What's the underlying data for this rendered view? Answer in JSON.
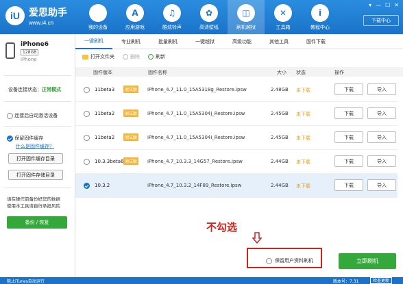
{
  "app": {
    "logo_mark": "iU",
    "name": "爱思助手",
    "url": "www.i4.cn",
    "download_center": "下载中心",
    "window_controls": [
      "▾",
      "—",
      "☐",
      "✕"
    ]
  },
  "nav": [
    {
      "label": "我的设备",
      "icon": "apple-icon",
      "glyph": ""
    },
    {
      "label": "应用游戏",
      "icon": "app-store-icon",
      "glyph": "A"
    },
    {
      "label": "酷炫铃声",
      "icon": "bell-icon",
      "glyph": "♫"
    },
    {
      "label": "高清壁纸",
      "icon": "wallpaper-icon",
      "glyph": "✿"
    },
    {
      "label": "刷机越狱",
      "icon": "flash-box-icon",
      "glyph": "◫",
      "active": true
    },
    {
      "label": "工具箱",
      "icon": "toolbox-icon",
      "glyph": "✕"
    },
    {
      "label": "教程中心",
      "icon": "info-icon",
      "glyph": "i"
    }
  ],
  "device": {
    "name": "iPhone6",
    "capacity": "128GB",
    "model": "iPhone"
  },
  "left": {
    "status_label": "设备连接状态：",
    "status_value": "正常模式",
    "auto_activate": "连接后自动激活设备",
    "keep_cache": "保留固件缓存",
    "cache_link": "什么是固件缓存？",
    "open_cache_dir": "打开固件缓存目录",
    "open_store_dir": "打开固件存储目录",
    "warning": "请在操作前备份好您的数据\n使用本工具请自行承担风险",
    "backup_button": "备份 / 恢复"
  },
  "tabs": [
    "一键刷机",
    "专业刷机",
    "批量刷机",
    "一键越狱",
    "高级功能",
    "其他工具",
    "固件下载"
  ],
  "toolbar": {
    "open_folder": "打开文件夹",
    "delete": "删除",
    "refresh": "刷新"
  },
  "table": {
    "headers": [
      "固件版本",
      "固件名称",
      "大小",
      "状态",
      "操作"
    ],
    "rows": [
      {
        "version": "11beta3",
        "badge": "测试版",
        "file": "iPhone_4.7_11.0_15A5318g_Restore.ipsw",
        "size": "2.48GB",
        "status": "未下载",
        "download": "下载",
        "import": "导入"
      },
      {
        "version": "11beta2",
        "badge": "测试版",
        "file": "iPhone_4.7_11.0_15A5304j_Restore.ipsw",
        "size": "2.45GB",
        "status": "未下载",
        "download": "下载",
        "import": "导入"
      },
      {
        "version": "11beta2",
        "badge": "测试版",
        "file": "iPhone_4.7_11.0_15A5304i_Restore.ipsw",
        "size": "2.45GB",
        "status": "未下载",
        "download": "下载",
        "import": "导入"
      },
      {
        "version": "10.3.3beta6",
        "badge": "测试版",
        "file": "iPhone_4.7_10.3.3_14G57_Restore.ipsw",
        "size": "2.44GB",
        "status": "未下载",
        "download": "下载",
        "import": "导入"
      },
      {
        "version": "10.3.2",
        "badge": "",
        "file": "iPhone_4.7_10.3.2_14F89_Restore.ipsw",
        "size": "2.44GB",
        "status": "未下载",
        "download": "下载",
        "import": "导入",
        "selected": true
      }
    ]
  },
  "annotation": "不勾选",
  "keep_user_data": "保留用户资料刷机",
  "flash_button": "立即刷机",
  "bottom": {
    "itunes": "阻止iTunes自动运行",
    "version": "版本号：7.31",
    "check_update": "检查更新"
  },
  "colors": {
    "primary": "#1a73c8",
    "green": "#35a83b",
    "red": "#d6201a",
    "orange": "#e8a11b"
  }
}
